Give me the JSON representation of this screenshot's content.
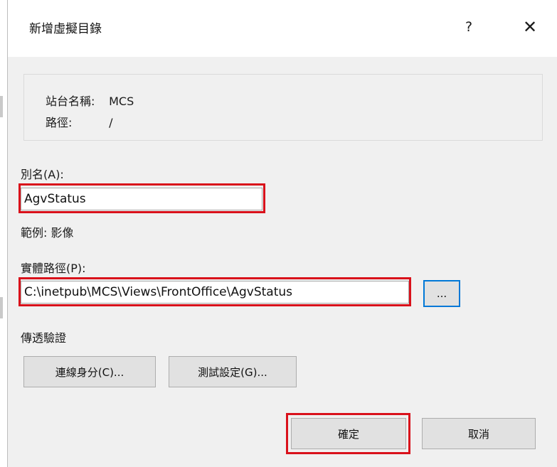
{
  "dialog": {
    "title": "新增虛擬目錄",
    "help_label": "?",
    "close_label": "✕"
  },
  "site_info": {
    "site_name_label": "站台名稱:",
    "site_name_value": "MCS",
    "path_label": "路徑:",
    "path_value": "/"
  },
  "alias": {
    "label": "別名(A):",
    "value": "AgvStatus",
    "example": "範例: 影像"
  },
  "physical_path": {
    "label": "實體路徑(P):",
    "value": "C:\\inetpub\\MCS\\Views\\FrontOffice\\AgvStatus",
    "browse_label": "..."
  },
  "pass_through": {
    "label": "傳透驗證",
    "connect_as_label": "連線身分(C)...",
    "test_settings_label": "測試設定(G)..."
  },
  "footer": {
    "ok_label": "確定",
    "cancel_label": "取消"
  },
  "colors": {
    "highlight_outline": "#d9111b",
    "focus_blue": "#0078d7",
    "dialog_bg": "#f0f0f0"
  }
}
